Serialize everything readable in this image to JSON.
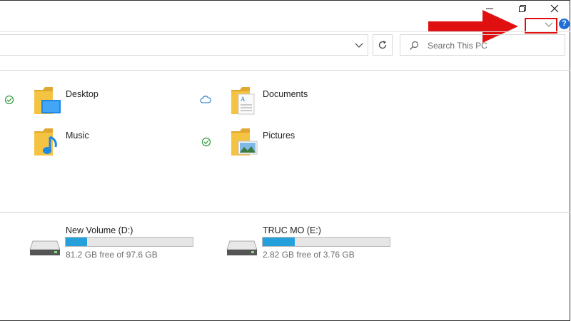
{
  "window": {
    "minimize_icon": "minimize-icon",
    "restore_icon": "restore-icon",
    "close_icon": "close-icon"
  },
  "ribbon": {
    "expand_icon": "chevron-down-icon",
    "help_glyph": "?",
    "highlight_color": "#e01010"
  },
  "search": {
    "placeholder": "Search This PC"
  },
  "folders": [
    {
      "label": "Desktop",
      "status_icon": "synced-check-icon"
    },
    {
      "label": "Documents",
      "status_icon": "cloud-icon"
    },
    {
      "label": "Music",
      "status_icon": ""
    },
    {
      "label": "Pictures",
      "status_icon": "synced-check-icon"
    }
  ],
  "drives": [
    {
      "label": "New Volume (D:)",
      "free_text": "81.2 GB free of 97.6 GB",
      "used_fraction": 0.168
    },
    {
      "label": "TRUC MO (E:)",
      "free_text": "2.82 GB free of 3.76 GB",
      "used_fraction": 0.25
    }
  ],
  "colors": {
    "accent_blue": "#26a0da",
    "folder_yellow": "#f5c342",
    "arrow_red": "#e01010"
  }
}
